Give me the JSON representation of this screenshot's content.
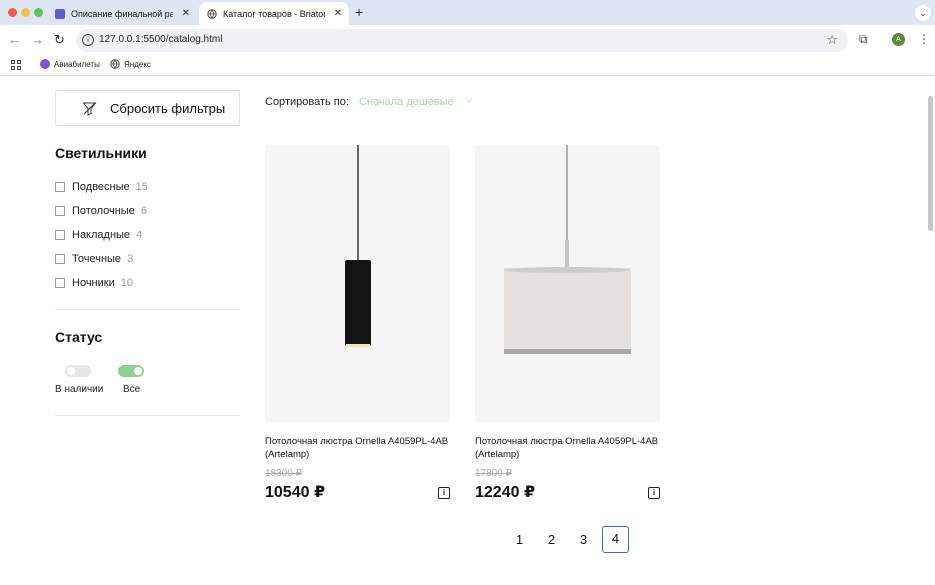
{
  "browser": {
    "tabs": [
      {
        "title": "Описание финальной работы",
        "close": "✕"
      },
      {
        "title": "Каталог товаров - Briaton",
        "close": "✕"
      }
    ],
    "new_tab": "+",
    "url": "127.0.0.1:5500/catalog.html",
    "avatar_letter": "A",
    "bookmarks": [
      {
        "label": "Авиабилеты"
      },
      {
        "label": "Яндекс"
      }
    ]
  },
  "filters": {
    "reset_label": "Сбросить фильтры",
    "sort_label": "Сортировать по:",
    "sort_value": "Сначала дешёвые",
    "category_title": "Светильники",
    "categories": [
      {
        "label": "Подвесные",
        "count": "15"
      },
      {
        "label": "Потолочные",
        "count": "6"
      },
      {
        "label": "Накладные",
        "count": "4"
      },
      {
        "label": "Точечные",
        "count": "3"
      },
      {
        "label": "Ночники",
        "count": "10"
      }
    ],
    "status_title": "Статус",
    "status": [
      {
        "label": "В наличии",
        "on": false
      },
      {
        "label": "Все",
        "on": true
      }
    ],
    "accent": "#8fd18f"
  },
  "products": [
    {
      "title": "Потолочная люстра Ornella A4059PL-4AB (Artelamp)",
      "old_price": "18300 ₽",
      "price": "10540 ₽",
      "info": "i"
    },
    {
      "title": "Потолочная люстра Ornella A4059PL-4AB (Artelamp)",
      "old_price": "17800 ₽",
      "price": "12240 ₽",
      "info": "i"
    }
  ],
  "pagination": {
    "pages": [
      "1",
      "2",
      "3",
      "4"
    ],
    "current": "4"
  }
}
